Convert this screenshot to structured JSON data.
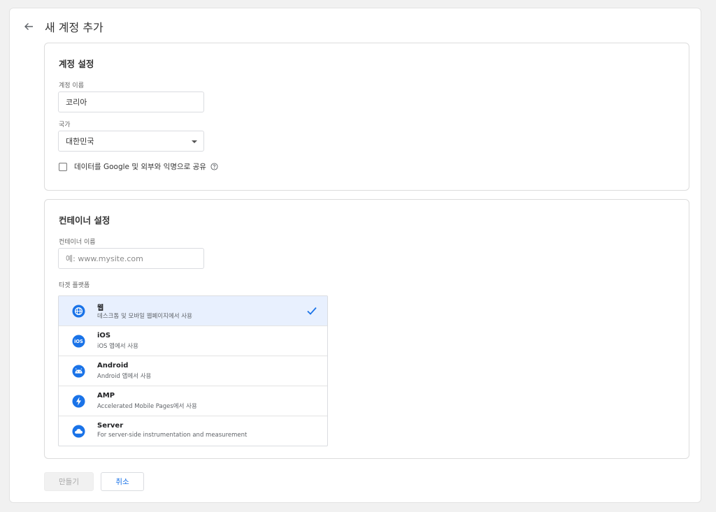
{
  "header": {
    "title": "새 계정 추가",
    "back_icon": "arrow-left-icon"
  },
  "account": {
    "title": "계정 설정",
    "name_label": "계정 이름",
    "name_value": "코리아",
    "country_label": "국가",
    "country_value": "대한민국",
    "share_label": "데이터를 Google 및 외부와 익명으로 공유"
  },
  "container": {
    "title": "컨테이너 설정",
    "name_label": "컨테이너 이름",
    "name_placeholder": "예: www.mysite.com",
    "platform_label": "타겟 플랫폼",
    "platforms": [
      {
        "name": "웹",
        "desc": "데스크톱 및 모바일 웹페이지에서 사용",
        "icon": "globe-icon",
        "selected": true
      },
      {
        "name": "iOS",
        "desc": "iOS 앱에서 사용",
        "icon": "ios-icon",
        "selected": false
      },
      {
        "name": "Android",
        "desc": "Android 앱에서 사용",
        "icon": "android-icon",
        "selected": false
      },
      {
        "name": "AMP",
        "desc": "Accelerated Mobile Pages에서 사용",
        "icon": "amp-bolt-icon",
        "selected": false
      },
      {
        "name": "Server",
        "desc": "For server-side instrumentation and measurement",
        "icon": "cloud-icon",
        "selected": false
      }
    ]
  },
  "buttons": {
    "create": "만들기",
    "cancel": "취소"
  },
  "colors": {
    "accent": "#1a73e8",
    "selected_bg": "#e8f0fe"
  }
}
